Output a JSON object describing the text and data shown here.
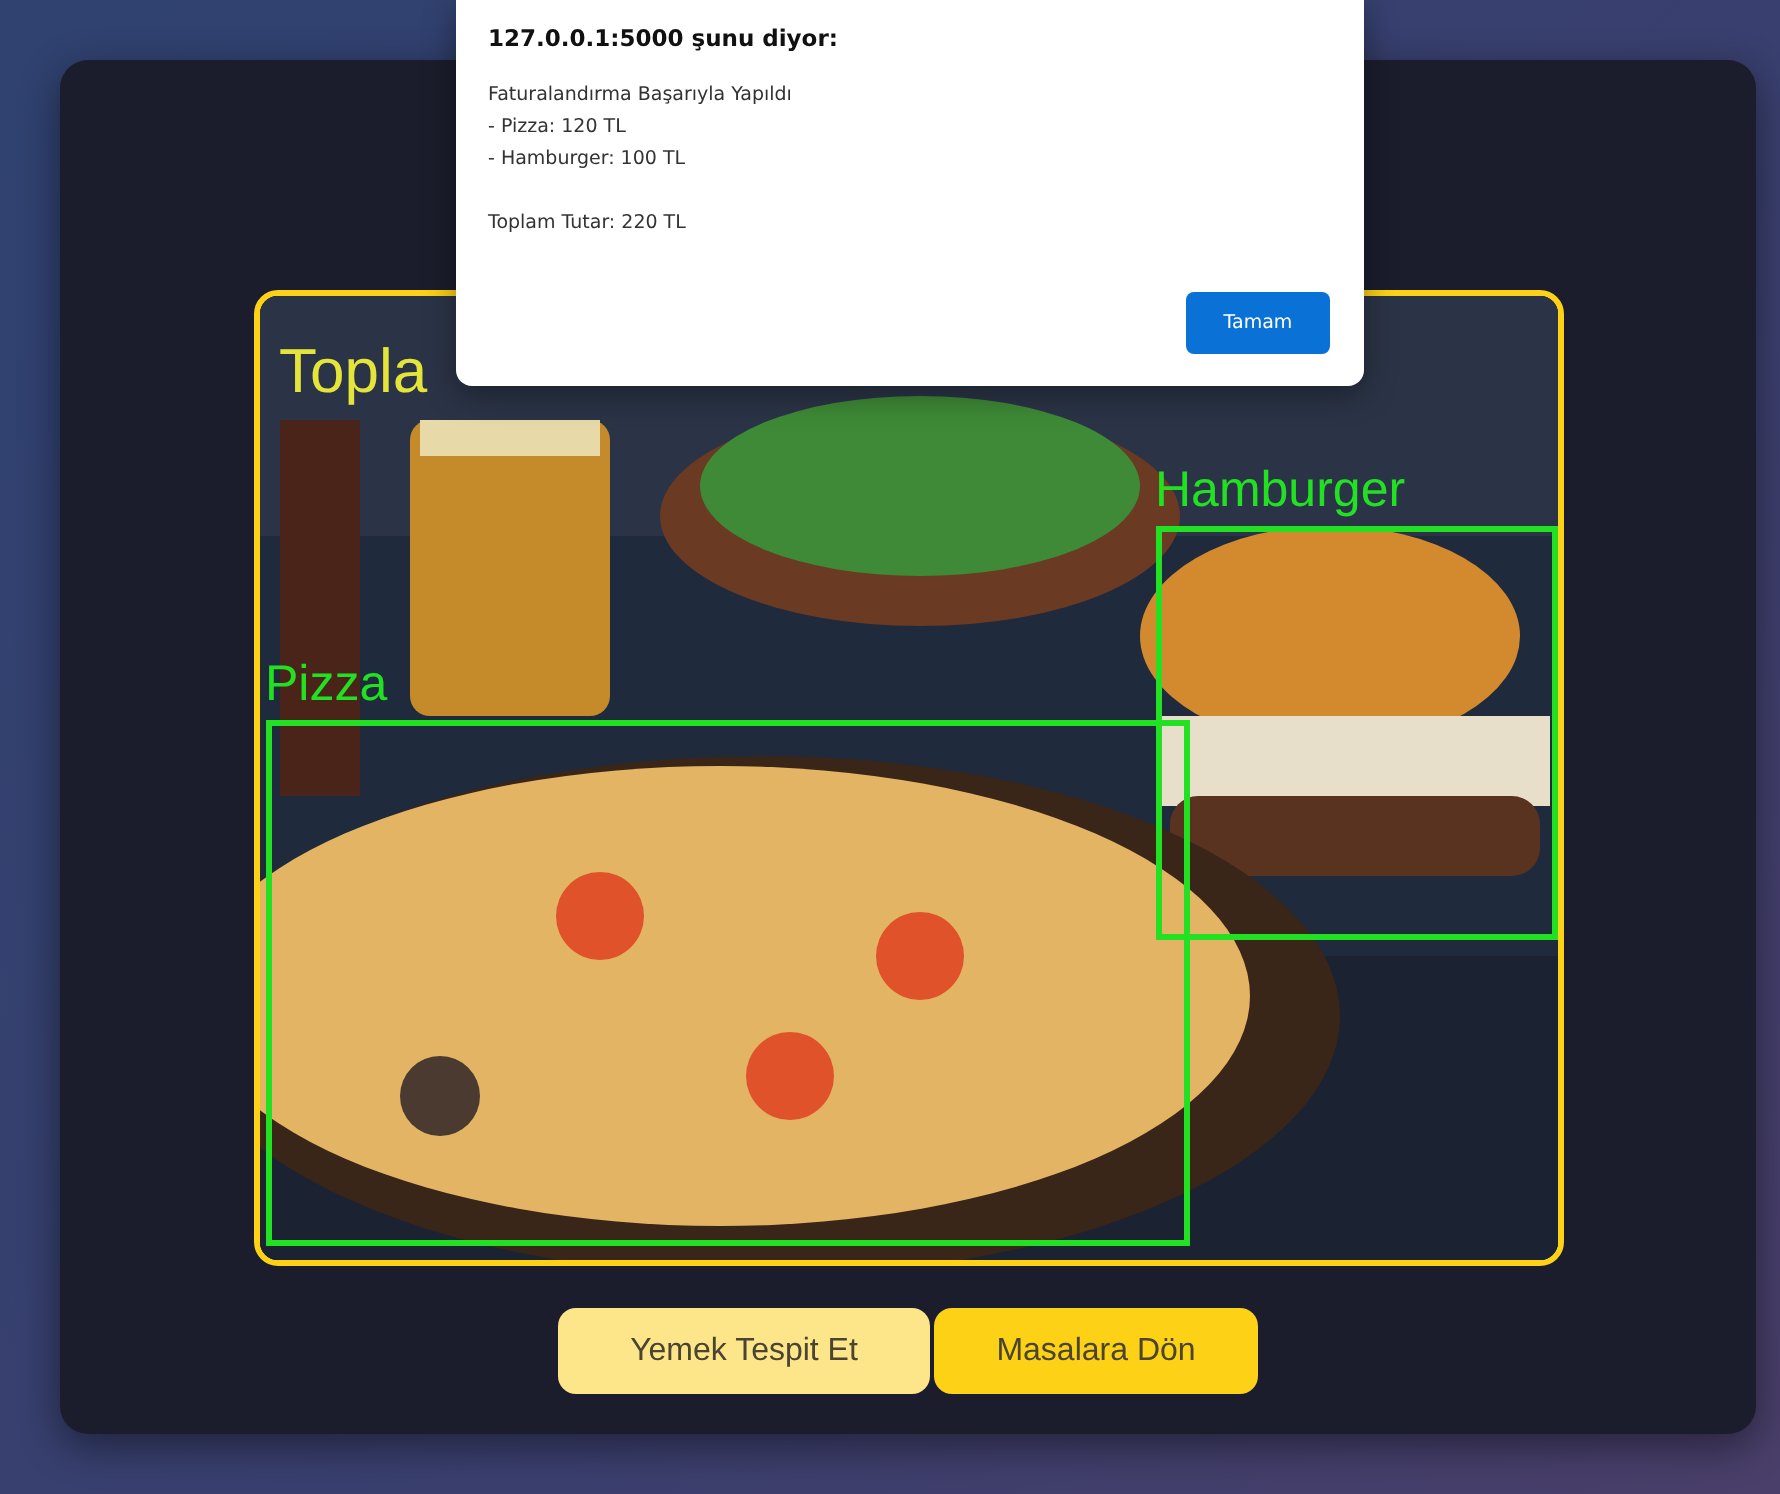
{
  "dialog": {
    "title": "127.0.0.1:5000 şunu diyor:",
    "heading": "Faturalandırma Başarıyla Yapıldı",
    "lines": [
      "- Pizza: 120 TL",
      "- Hamburger: 100 TL"
    ],
    "total": "Toplam Tutar: 220 TL",
    "button": "Tamam"
  },
  "image": {
    "kind": "picture",
    "total_label": "Topla",
    "detections": [
      {
        "label": "Hamburger"
      },
      {
        "label": "Pizza"
      }
    ]
  },
  "buttons": [
    {
      "label": "Yemek Tespit Et",
      "kind": "light"
    },
    {
      "label": "Masalara Dön",
      "kind": "strong"
    }
  ]
}
